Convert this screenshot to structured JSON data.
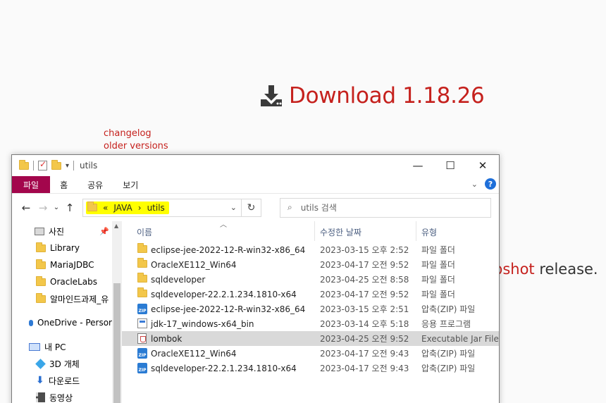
{
  "webpage": {
    "download_label": "Download 1.18.26",
    "links": [
      "changelog",
      "older versions"
    ],
    "snapshot_red": "pshot",
    "snapshot_rest": " release."
  },
  "window": {
    "title": "utils",
    "ribbon_tabs": [
      "파일",
      "홈",
      "공유",
      "보기"
    ],
    "breadcrumb": [
      "JAVA",
      "utils"
    ],
    "search_placeholder": "utils 검색",
    "columns": [
      "이름",
      "수정한 날짜",
      "유형"
    ]
  },
  "nav_items": [
    {
      "label": "사진",
      "icon": "pictures-icon"
    },
    {
      "label": "Library",
      "icon": "folder-icon"
    },
    {
      "label": "MariaJDBC",
      "icon": "folder-icon"
    },
    {
      "label": "OracleLabs",
      "icon": "folder-icon"
    },
    {
      "label": "알마인드과제_유",
      "icon": "folder-icon"
    },
    {
      "label": "OneDrive - Persor",
      "icon": "onedrive-icon"
    },
    {
      "label": "내 PC",
      "icon": "pc-icon"
    },
    {
      "label": "3D 개체",
      "icon": "3d-objects-icon"
    },
    {
      "label": "다운로드",
      "icon": "downloads-icon"
    },
    {
      "label": "동영상",
      "icon": "videos-icon"
    }
  ],
  "files": [
    {
      "name": "eclipse-jee-2022-12-R-win32-x86_64",
      "date": "2023-03-15 오후 2:52",
      "type": "파일 폴더",
      "icon": "folder-icon"
    },
    {
      "name": "OracleXE112_Win64",
      "date": "2023-04-17 오전 9:52",
      "type": "파일 폴더",
      "icon": "folder-icon"
    },
    {
      "name": "sqldeveloper",
      "date": "2023-04-25 오전 8:58",
      "type": "파일 폴더",
      "icon": "folder-icon"
    },
    {
      "name": "sqldeveloper-22.2.1.234.1810-x64",
      "date": "2023-04-17 오전 9:52",
      "type": "파일 폴더",
      "icon": "folder-icon"
    },
    {
      "name": "eclipse-jee-2022-12-R-win32-x86_64",
      "date": "2023-03-15 오후 2:51",
      "type": "압축(ZIP) 파일",
      "icon": "zip-icon"
    },
    {
      "name": "jdk-17_windows-x64_bin",
      "date": "2023-03-14 오후 5:18",
      "type": "응용 프로그램",
      "icon": "exe-icon"
    },
    {
      "name": "lombok",
      "date": "2023-04-25 오전 9:52",
      "type": "Executable Jar File",
      "icon": "jar-icon",
      "selected": true
    },
    {
      "name": "OracleXE112_Win64",
      "date": "2023-04-17 오전 9:43",
      "type": "압축(ZIP) 파일",
      "icon": "zip-icon"
    },
    {
      "name": "sqldeveloper-22.2.1.234.1810-x64",
      "date": "2023-04-17 오전 9:43",
      "type": "압축(ZIP) 파일",
      "icon": "zip-icon"
    }
  ],
  "colors": {
    "accent_red": "#c5211d",
    "ribbon_file_tab": "#a3064c",
    "highlight": "#ffff00"
  }
}
